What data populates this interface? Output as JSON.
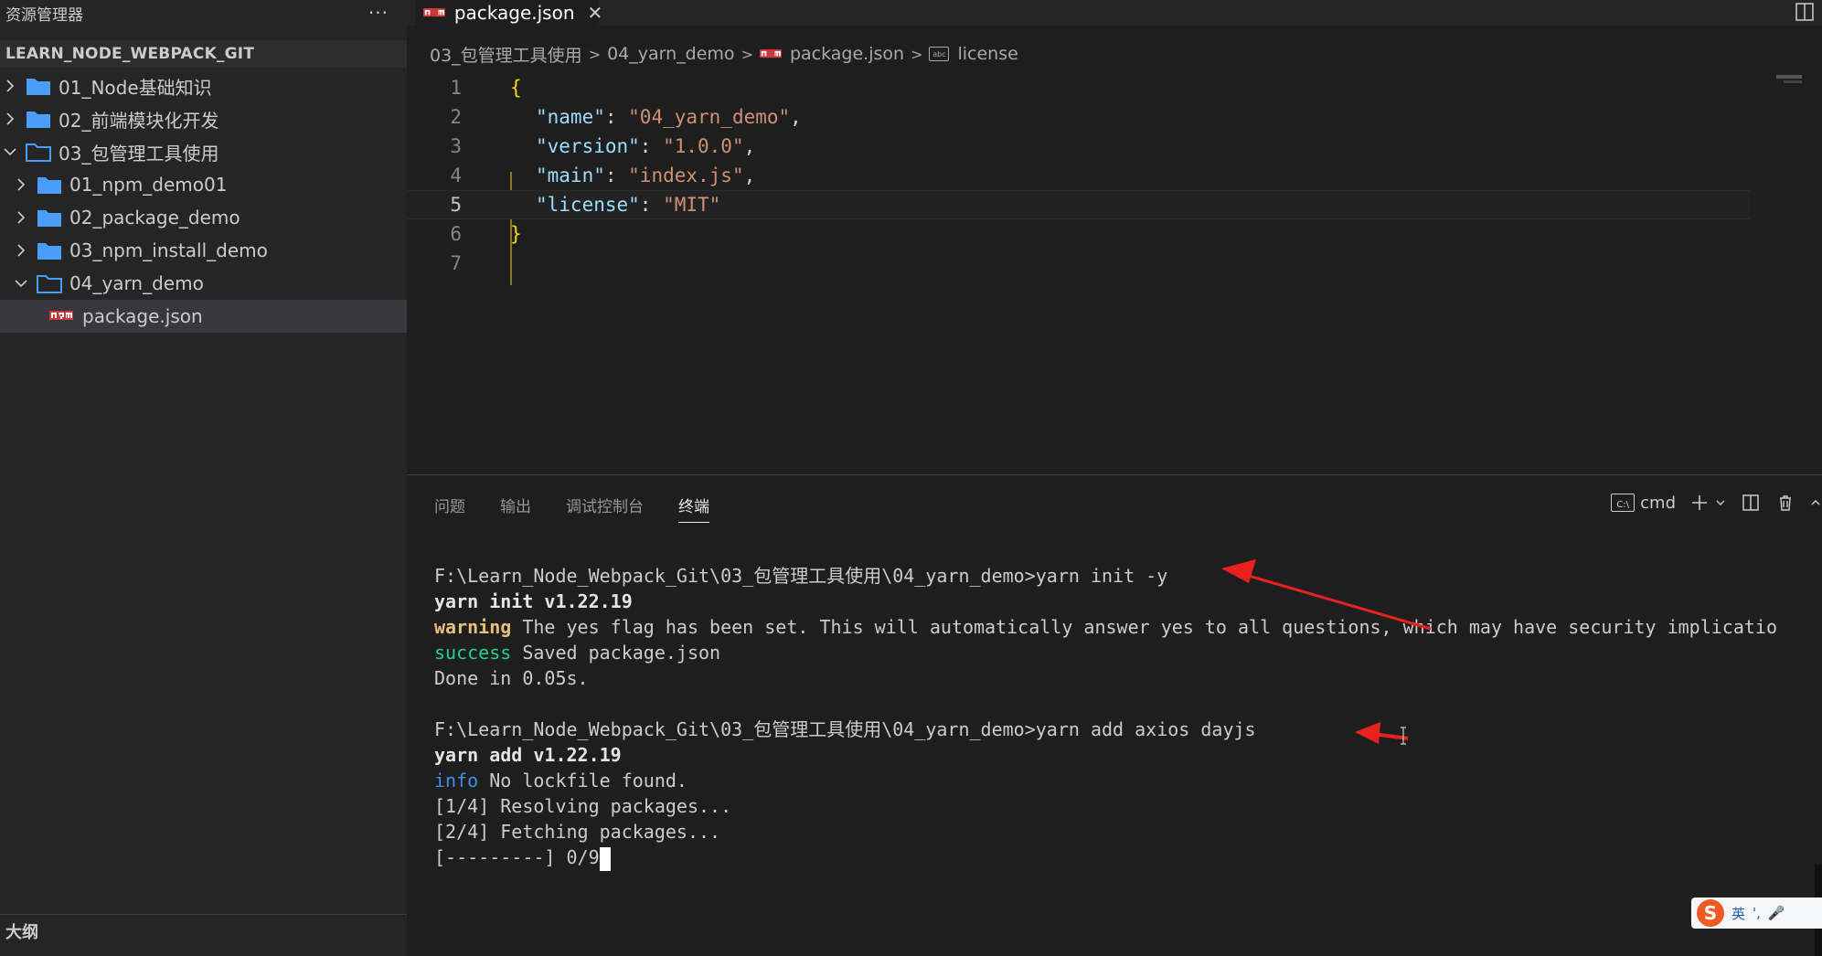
{
  "sidebar": {
    "title": "资源管理器",
    "more": "···",
    "section": "LEARN_NODE_WEBPACK_GIT",
    "items": [
      {
        "label": "01_Node基础知识"
      },
      {
        "label": "02_前端模块化开发"
      },
      {
        "label": "03_包管理工具使用"
      },
      {
        "label": "01_npm_demo01"
      },
      {
        "label": "02_package_demo"
      },
      {
        "label": "03_npm_install_demo"
      },
      {
        "label": "04_yarn_demo"
      },
      {
        "label": "package.json"
      }
    ],
    "outline": "大纲"
  },
  "tab": {
    "label": "package.json",
    "close": "✕"
  },
  "breadcrumbs": [
    "03_包管理工具使用",
    "04_yarn_demo",
    "package.json",
    "license"
  ],
  "editor": {
    "line_numbers": [
      "1",
      "2",
      "3",
      "4",
      "5",
      "6",
      "7"
    ],
    "current_line": 5,
    "lines": [
      {
        "brace": "{"
      },
      {
        "key": "\"name\"",
        "colon": ": ",
        "value": "\"04_yarn_demo\"",
        "comma": ","
      },
      {
        "key": "\"version\"",
        "colon": ": ",
        "value": "\"1.0.0\"",
        "comma": ","
      },
      {
        "key": "\"main\"",
        "colon": ": ",
        "value": "\"index.js\"",
        "comma": ","
      },
      {
        "key": "\"license\"",
        "colon": ": ",
        "value": "\"MIT\"",
        "comma": ""
      },
      {
        "brace": "}"
      },
      {}
    ]
  },
  "panel": {
    "tabs": [
      "问题",
      "输出",
      "调试控制台",
      "终端"
    ],
    "active_tab": "终端",
    "shell": "cmd"
  },
  "terminal": {
    "prompt1": "F:\\Learn_Node_Webpack_Git\\03_包管理工具使用\\04_yarn_demo>yarn init -y",
    "line2": "yarn init v1.22.19",
    "warn_tag": "warning",
    "warn_text": " The yes flag has been set. This will automatically answer yes to all questions, which may have security implicatio",
    "success_tag": "success",
    "success_text": " Saved package.json",
    "done": "Done in 0.05s.",
    "prompt2": "F:\\Learn_Node_Webpack_Git\\03_包管理工具使用\\04_yarn_demo>yarn add axios dayjs",
    "line7": "yarn add v1.22.19",
    "info_tag": "info",
    "info_text": " No lockfile found.",
    "step1": "[1/4] Resolving packages...",
    "step2": "[2/4] Fetching packages...",
    "progress": "[---------] 0/9"
  },
  "ime": {
    "lang": "英",
    "punct": "',",
    "mic": "🎤"
  },
  "colors": {
    "accent_arrow": "#e8211f",
    "folder": "#4a9df8"
  }
}
